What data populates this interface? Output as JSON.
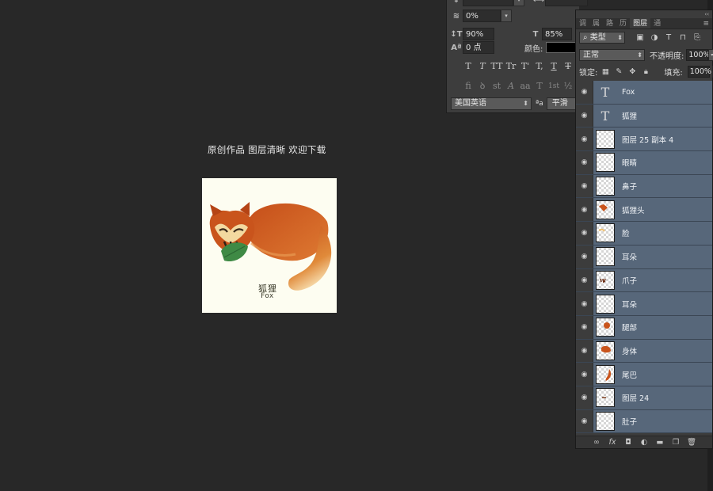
{
  "canvas": {
    "caption": "原创作品 图层清晰 欢迎下载",
    "artwork_label_cn": "狐狸",
    "artwork_label_en": "Fox"
  },
  "character_panel": {
    "tracking": "0%",
    "vertical_scale": "90%",
    "horizontal_scale": "85%",
    "baseline_shift": "0 点",
    "color_label": "颜色:",
    "color_value": "#000000",
    "style_buttons": [
      "T",
      "T",
      "TT",
      "Tr",
      "T'",
      "T,",
      "T",
      "T"
    ],
    "opentype_buttons": [
      "fi",
      "ꝺ",
      "st",
      "A",
      "aa",
      "T",
      "1st",
      "½"
    ],
    "language": "美国英语",
    "aa_symbol": "ªa",
    "antialias": "平滑"
  },
  "layers_panel": {
    "tabs": [
      "调",
      "属",
      "路",
      "历",
      "图层",
      "通"
    ],
    "active_tab": "图层",
    "filter_type": "类型",
    "blend_mode": "正常",
    "opacity_label": "不透明度:",
    "opacity_value": "100%",
    "lock_label": "锁定:",
    "fill_label": "填充:",
    "fill_value": "100%",
    "layers": [
      {
        "name": "Fox",
        "kind": "text"
      },
      {
        "name": "狐狸",
        "kind": "text"
      },
      {
        "name": "图层 25 副本 4",
        "kind": "pixel"
      },
      {
        "name": "眼睛",
        "kind": "pixel"
      },
      {
        "name": "鼻子",
        "kind": "pixel"
      },
      {
        "name": "狐狸头",
        "kind": "pixel"
      },
      {
        "name": "脸",
        "kind": "pixel"
      },
      {
        "name": "耳朵",
        "kind": "pixel"
      },
      {
        "name": "爪子",
        "kind": "pixel"
      },
      {
        "name": "耳朵",
        "kind": "pixel"
      },
      {
        "name": "腿部",
        "kind": "pixel"
      },
      {
        "name": "身体",
        "kind": "pixel"
      },
      {
        "name": "尾巴",
        "kind": "pixel"
      },
      {
        "name": "图层 24",
        "kind": "pixel"
      },
      {
        "name": "肚子",
        "kind": "pixel"
      }
    ]
  },
  "colors": {
    "background": "#282828",
    "panel": "#3c3c3c",
    "selected_layer": "#57677a",
    "fox_orange": "#c9541c",
    "leaf_green": "#3f8a45"
  }
}
